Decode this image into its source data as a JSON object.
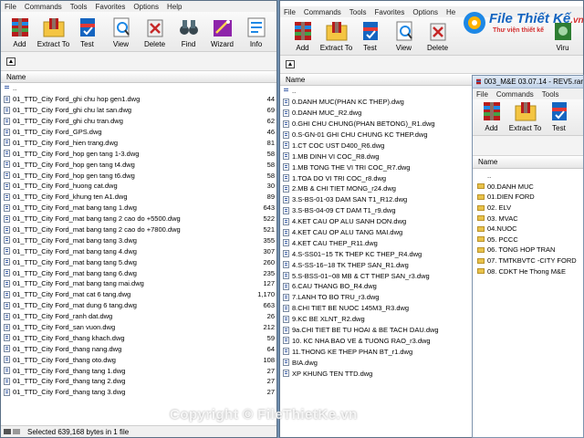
{
  "w1": {
    "menu": [
      "File",
      "Commands",
      "Tools",
      "Favorites",
      "Options",
      "Help"
    ],
    "toolbar": [
      "Add",
      "Extract To",
      "Test",
      "View",
      "Delete",
      "Find",
      "Wizard",
      "Info"
    ],
    "column": "Name",
    "rows": [
      {
        "name": "..",
        "size": ""
      },
      {
        "name": "01_TTD_City Ford_ghi chu hop gen1.dwg",
        "size": "44"
      },
      {
        "name": "01_TTD_City Ford_ghi chu lat san.dwg",
        "size": "69"
      },
      {
        "name": "01_TTD_City Ford_ghi chu tran.dwg",
        "size": "62"
      },
      {
        "name": "01_TTD_City Ford_GPS.dwg",
        "size": "46"
      },
      {
        "name": "01_TTD_City Ford_hien trang.dwg",
        "size": "81"
      },
      {
        "name": "01_TTD_City Ford_hop gen tang 1-3.dwg",
        "size": "58"
      },
      {
        "name": "01_TTD_City Ford_hop gen tang t4.dwg",
        "size": "58"
      },
      {
        "name": "01_TTD_City Ford_hop gen tang t6.dwg",
        "size": "58"
      },
      {
        "name": "01_TTD_City Ford_huong cat.dwg",
        "size": "30"
      },
      {
        "name": "01_TTD_City Ford_khung ten A1.dwg",
        "size": "89"
      },
      {
        "name": "01_TTD_City Ford_mat bang tang 1.dwg",
        "size": "643"
      },
      {
        "name": "01_TTD_City Ford_mat bang tang 2 cao do +5500.dwg",
        "size": "522"
      },
      {
        "name": "01_TTD_City Ford_mat bang tang 2 cao do +7800.dwg",
        "size": "521"
      },
      {
        "name": "01_TTD_City Ford_mat bang tang 3.dwg",
        "size": "355"
      },
      {
        "name": "01_TTD_City Ford_mat bang tang 4.dwg",
        "size": "307"
      },
      {
        "name": "01_TTD_City Ford_mat bang tang 5.dwg",
        "size": "260"
      },
      {
        "name": "01_TTD_City Ford_mat bang tang 6.dwg",
        "size": "235"
      },
      {
        "name": "01_TTD_City Ford_mat bang tang mai.dwg",
        "size": "127"
      },
      {
        "name": "01_TTD_City Ford_mat cat 6 tang.dwg",
        "size": "1,170"
      },
      {
        "name": "01_TTD_City Ford_mat dung 6 tang.dwg",
        "size": "663"
      },
      {
        "name": "01_TTD_City Ford_ranh dat.dwg",
        "size": "26"
      },
      {
        "name": "01_TTD_City Ford_san vuon.dwg",
        "size": "212"
      },
      {
        "name": "01_TTD_City Ford_thang khach.dwg",
        "size": "59"
      },
      {
        "name": "01_TTD_City Ford_thang nang.dwg",
        "size": "64"
      },
      {
        "name": "01_TTD_City Ford_thang oto.dwg",
        "size": "108"
      },
      {
        "name": "01_TTD_City Ford_thang tang 1.dwg",
        "size": "27"
      },
      {
        "name": "01_TTD_City Ford_thang tang 2.dwg",
        "size": "27"
      },
      {
        "name": "01_TTD_City Ford_thang tang 3.dwg",
        "size": "27"
      }
    ],
    "status": "Selected 639,168 bytes in 1 file"
  },
  "w2": {
    "menu": [
      "File",
      "Commands",
      "Tools",
      "Favorites",
      "Options",
      "He"
    ],
    "toolbar": [
      "Add",
      "Extract To",
      "Test",
      "View",
      "Delete",
      "Viru"
    ],
    "column": "Name",
    "rows": [
      "..",
      "0.DANH MUC(PHAN KC THEP).dwg",
      "0.DANH MUC_R2.dwg",
      "0.GHI CHU CHUNG(PHAN BETONG)_R1.dwg",
      "0.S-GN-01 GHI CHU CHUNG KC THEP.dwg",
      "1.CT COC UST D400_R6.dwg",
      "1.MB DINH VI COC_R8.dwg",
      "1.MB TONG THE VI TRI COC_R7.dwg",
      "1.TOA DO VI TRI COC_r8.dwg",
      "2.MB & CHI TIET MONG_r24.dwg",
      "3.S-BS-01-03 DAM SAN T1_R12.dwg",
      "3.S-BS-04-09 CT DAM T1_r9.dwg",
      "4.KET CAU OP ALU SANH DON.dwg",
      "4.KET CAU OP ALU TANG MAI.dwg",
      "4.KET CAU THEP_R11.dwg",
      "4.S-SS01~15 TK THEP KC THEP_R4.dwg",
      "4.S-SS-16~18 TK THEP SAN_R1.dwg",
      "5.S-BSS-01~08 MB & CT THEP SAN_r3.dwg",
      "6.CAU THANG BO_R4.dwg",
      "7.LANH TO BO TRU_r3.dwg",
      "8.CHI TIET BE NUOC 145M3_R3.dwg",
      "9.KC BE XLNT_R2.dwg",
      "9a.CHI TIET BE TU HOAI & BE TACH DAU.dwg",
      "10. KC NHA BAO VE & TUONG RAO_r3.dwg",
      "11.THONG KE THEP PHAN BT_r1.dwg",
      "BIA.dwg",
      "XP KHUNG TEN TTD.dwg"
    ]
  },
  "w3": {
    "title": "003_M&E 03.07.14 - REV5.rar",
    "menu": [
      "File",
      "Commands",
      "Tools"
    ],
    "toolbar": [
      "Add",
      "Extract To",
      "Test"
    ],
    "column": "Name",
    "rows": [
      "..",
      "00.DANH MUC",
      "01.DIEN FORD",
      "02. ELV",
      "03. MVAC",
      "04.NUOC",
      "05. PCCC",
      "06. TONG HOP TRAN",
      "07. TMTKBVTC -CITY FORD",
      "08. CDKT He Thong M&E"
    ]
  },
  "logo": {
    "name": "File Thiết Kế",
    "suffix": ".vn",
    "tagline": "Thư viện thiết kế"
  },
  "watermark": "Copyright © FileThietKe.vn"
}
